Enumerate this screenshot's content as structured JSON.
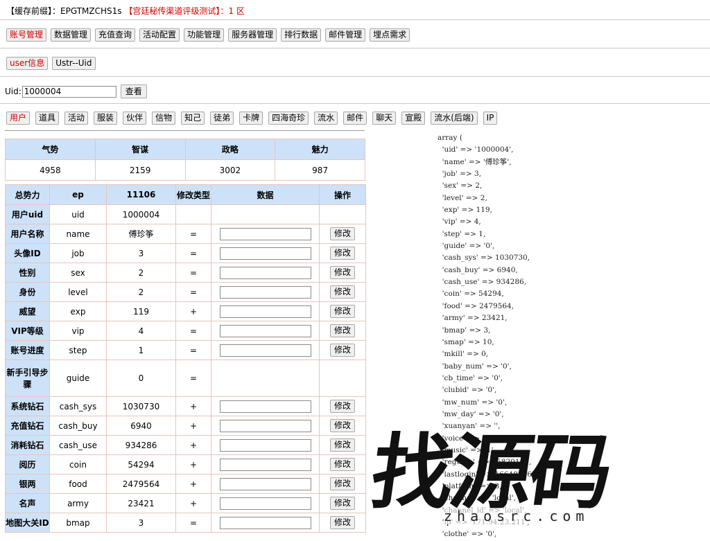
{
  "header": {
    "prefix": "【缓存前缀】：EPGTMZCHS1s",
    "server": "【宫廷秘传渠道评级测试】：1 区"
  },
  "menu": [
    "账号管理",
    "数据管理",
    "充值查询",
    "活动配置",
    "功能管理",
    "服务器管理",
    "排行数据",
    "邮件管理",
    "埋点需求"
  ],
  "menu_active": 0,
  "submenu": [
    "user信息",
    "Ustr--Uid"
  ],
  "submenu_active": 0,
  "uid_search": {
    "label": "Uid:",
    "value": "1000004",
    "button": "查看"
  },
  "tabs": [
    "用户",
    "道具",
    "活动",
    "服装",
    "伙伴",
    "信物",
    "知己",
    "徒弟",
    "卡牌",
    "四海奇珍",
    "流水",
    "邮件",
    "聊天",
    "宣殿",
    "流水(后端)",
    "IP"
  ],
  "tabs_active": 0,
  "stats": {
    "headers": [
      "气势",
      "智谋",
      "政略",
      "魅力"
    ],
    "values": [
      "4958",
      "2159",
      "3002",
      "987"
    ]
  },
  "table": {
    "headers": [
      "总势力",
      "ep",
      "11106",
      "修改类型",
      "数据",
      "操作"
    ],
    "modify_label": "修改",
    "rows": [
      {
        "label": "用户uid",
        "key": "uid",
        "value": "1000004",
        "op": "",
        "editable": false
      },
      {
        "label": "用户名称",
        "key": "name",
        "value": "傅珍筝",
        "op": "=",
        "editable": true
      },
      {
        "label": "头像ID",
        "key": "job",
        "value": "3",
        "op": "=",
        "editable": true
      },
      {
        "label": "性别",
        "key": "sex",
        "value": "2",
        "op": "=",
        "editable": true
      },
      {
        "label": "身份",
        "key": "level",
        "value": "2",
        "op": "=",
        "editable": true
      },
      {
        "label": "威望",
        "key": "exp",
        "value": "119",
        "op": "+",
        "editable": true
      },
      {
        "label": "VIP等级",
        "key": "vip",
        "value": "4",
        "op": "=",
        "editable": true
      },
      {
        "label": "账号进度",
        "key": "step",
        "value": "1",
        "op": "=",
        "editable": true
      },
      {
        "label": "新手引导步骤",
        "key": "guide",
        "value": "0",
        "op": "=",
        "editable": false
      },
      {
        "label": "系统钻石",
        "key": "cash_sys",
        "value": "1030730",
        "op": "+",
        "editable": true
      },
      {
        "label": "充值钻石",
        "key": "cash_buy",
        "value": "6940",
        "op": "+",
        "editable": true
      },
      {
        "label": "消耗钻石",
        "key": "cash_use",
        "value": "934286",
        "op": "+",
        "editable": true
      },
      {
        "label": "阅历",
        "key": "coin",
        "value": "54294",
        "op": "+",
        "editable": true
      },
      {
        "label": "银两",
        "key": "food",
        "value": "2479564",
        "op": "+",
        "editable": true
      },
      {
        "label": "名声",
        "key": "army",
        "value": "23421",
        "op": "+",
        "editable": true
      },
      {
        "label": "地图大关ID",
        "key": "bmap",
        "value": "3",
        "op": "=",
        "editable": true
      }
    ]
  },
  "dump_lines": [
    "array (",
    "  'uid' => '1000004',",
    "  'name' => '傅珍筝',",
    "  'job' => 3,",
    "  'sex' => 2,",
    "  'level' => 2,",
    "  'exp' => 119,",
    "  'vip' => 4,",
    "  'step' => 1,",
    "  'guide' => '0',",
    "  'cash_sys' => 1030730,",
    "  'cash_buy' => 6940,",
    "  'cash_use' => 934286,",
    "  'coin' => 54294,",
    "  'food' => 2479564,",
    "  'army' => 23421,",
    "  'bmap' => 3,",
    "  'smap' => 10,",
    "  'mkill' => 0,",
    "  'baby_num' => '0',",
    "  'cb_time' => '0',",
    "  'clubid' => '0',",
    "  'mw_num' => '0',",
    "  'mw_day' => '0',",
    "  'xuanyan' => '',",
    "  'voice' => '1',",
    "  'music' => '1',",
    "  'regtime' => 15820160,",
    "  'lastlogin' => 1664828655,",
    "  'platform' => 3,",
    "  'channel' => 'local',",
    "  'channel_id' => 'local',",
    "  'ip' => '171.94.23.211',",
    "  'clothe' => '0',"
  ],
  "watermark": {
    "text": "找源码",
    "url": "zhaosrc.com"
  }
}
